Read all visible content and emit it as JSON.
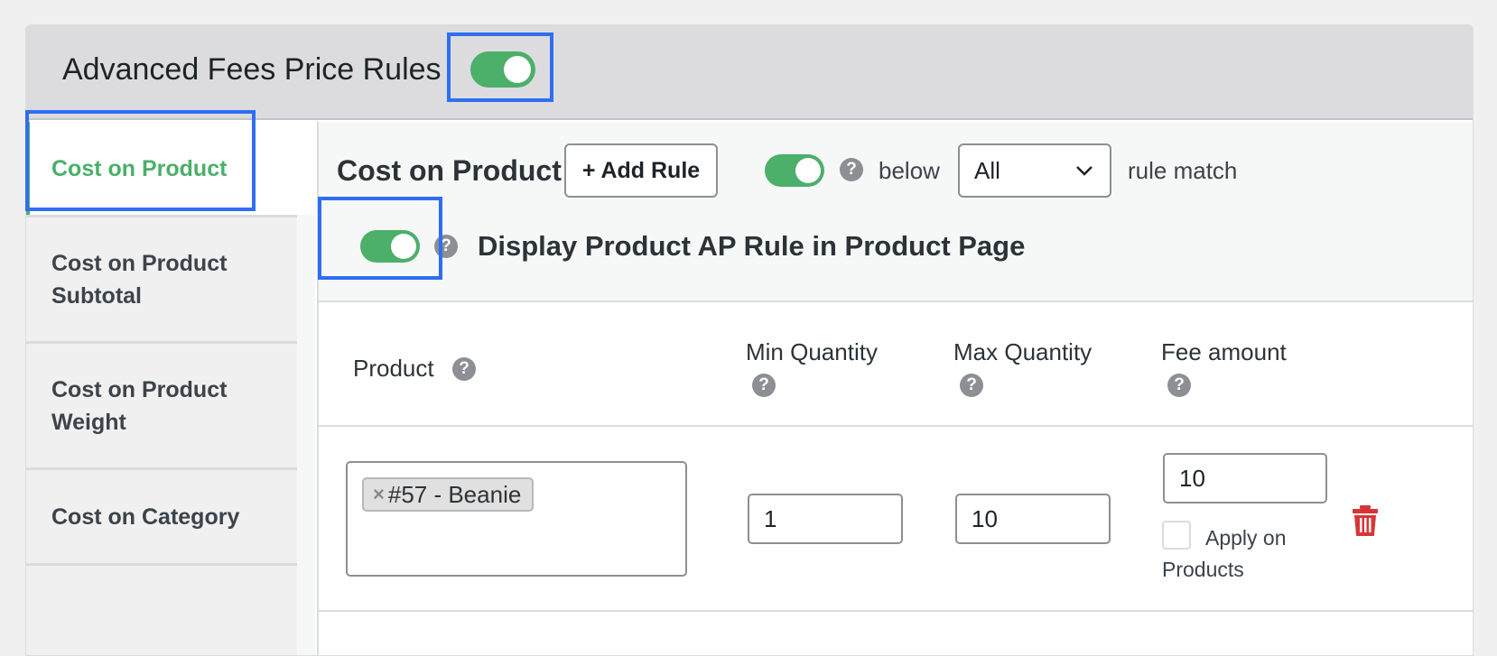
{
  "header": {
    "title": "Advanced Fees Price Rules",
    "enabled": true
  },
  "sidebar": {
    "items": [
      {
        "label": "Cost on Product",
        "active": true
      },
      {
        "label": "Cost on Product Subtotal",
        "active": false
      },
      {
        "label": "Cost on Product Weight",
        "active": false
      },
      {
        "label": "Cost on Category",
        "active": false
      }
    ]
  },
  "main": {
    "section_title": "Cost on Product",
    "add_rule_label": "+ Add Rule",
    "rule_toggle_enabled": true,
    "below_label": "below",
    "match_select_value": "All",
    "rule_match_label": "rule match",
    "display_toggle_enabled": true,
    "display_label": "Display Product AP Rule in Product Page",
    "columns": {
      "product": "Product",
      "min_quantity": "Min Quantity",
      "max_quantity": "Max Quantity",
      "fee_amount": "Fee amount"
    },
    "row": {
      "product_chip": "#57 - Beanie",
      "min_quantity": "1",
      "max_quantity": "10",
      "fee_amount": "10",
      "apply_on_line1": "Apply on",
      "apply_on_line2": "Products"
    }
  },
  "colors": {
    "accent": "#4caf6a",
    "highlight": "#2f6ef1",
    "danger": "#d63638"
  },
  "icons": [
    "help-icon",
    "chevron-down-icon",
    "close-icon",
    "trash-icon"
  ]
}
